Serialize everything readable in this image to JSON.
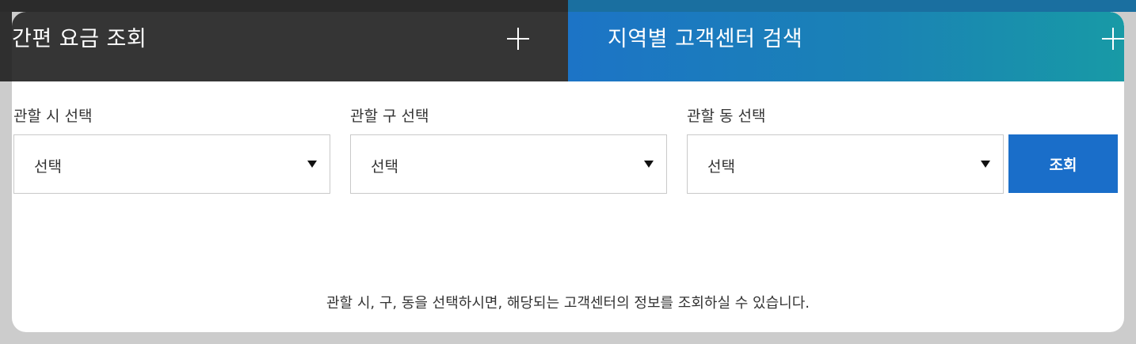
{
  "tabs": {
    "left": {
      "title": "간편 요금 조회"
    },
    "right": {
      "title": "지역별 고객센터 검색"
    }
  },
  "fields": [
    {
      "label": "관할 시 선택",
      "value": "선택"
    },
    {
      "label": "관할 구 선택",
      "value": "선택"
    },
    {
      "label": "관할 동 선택",
      "value": "선택"
    }
  ],
  "search_button": "조회",
  "help_text": "관할 시, 구, 동을 선택하시면, 해당되는 고객센터의 정보를 조회하실 수 있습니다.",
  "colors": {
    "left_tab": "#353535",
    "right_tab": "#1c74c6",
    "button": "#1a6ec9"
  }
}
